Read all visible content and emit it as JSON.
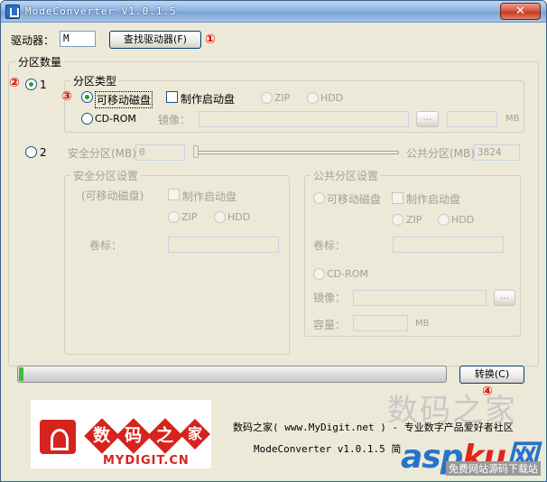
{
  "window": {
    "title": "ModeConverter V1.0.1.5",
    "close_glyph": "✕"
  },
  "drive": {
    "label": "驱动器：",
    "value": "M",
    "find_button": "查找驱动器(F)"
  },
  "annotations": {
    "n1": "①",
    "n2": "②",
    "n3": "③",
    "n4": "④"
  },
  "partition_count": {
    "group_title": "分区数量",
    "option1_label": "1",
    "option2_label": "2"
  },
  "partition_type": {
    "group_title": "分区类型",
    "removable_label": "可移动磁盘",
    "make_boot_label": "制作启动盘",
    "zip_label": "ZIP",
    "hdd_label": "HDD",
    "cdrom_label": "CD-ROM",
    "image_label": "镜像：",
    "mb_label": "MB"
  },
  "split": {
    "secure_label": "安全分区(MB)",
    "secure_value": "0",
    "public_label": "公共分区(MB)",
    "public_value": "3824"
  },
  "secure_settings": {
    "group_title": "安全分区设置",
    "removable_label": "(可移动磁盘)",
    "make_boot_label": "制作启动盘",
    "zip_label": "ZIP",
    "hdd_label": "HDD",
    "volume_label": "卷标："
  },
  "public_settings": {
    "group_title": "公共分区设置",
    "removable_label": "可移动磁盘",
    "make_boot_label": "制作启动盘",
    "zip_label": "ZIP",
    "hdd_label": "HDD",
    "volume_label": "卷标：",
    "cdrom_label": "CD-ROM",
    "image_label": "镜像：",
    "capacity_label": "容量：",
    "mb_label": "MB"
  },
  "convert": {
    "button_label": "转换(C)",
    "progress": 0.01
  },
  "footer": {
    "line1": "数码之家( www.MyDigit.net ) - 专业数字产品爱好者社区",
    "line2": "ModeConverter v1.0.1.5 简",
    "logo_text": "MYDIGIT.CN",
    "logo_chars": [
      "数",
      "码",
      "之",
      "家"
    ]
  },
  "watermark": {
    "top": "数码之家",
    "brand_a": "asp",
    "brand_b": "ku",
    "brand_c": "网",
    "sub": "免费网站源码下载站"
  },
  "colors": {
    "accent_red": "#e10000",
    "radio_green": "#21a121",
    "progress_green": "#3dbb3d"
  }
}
